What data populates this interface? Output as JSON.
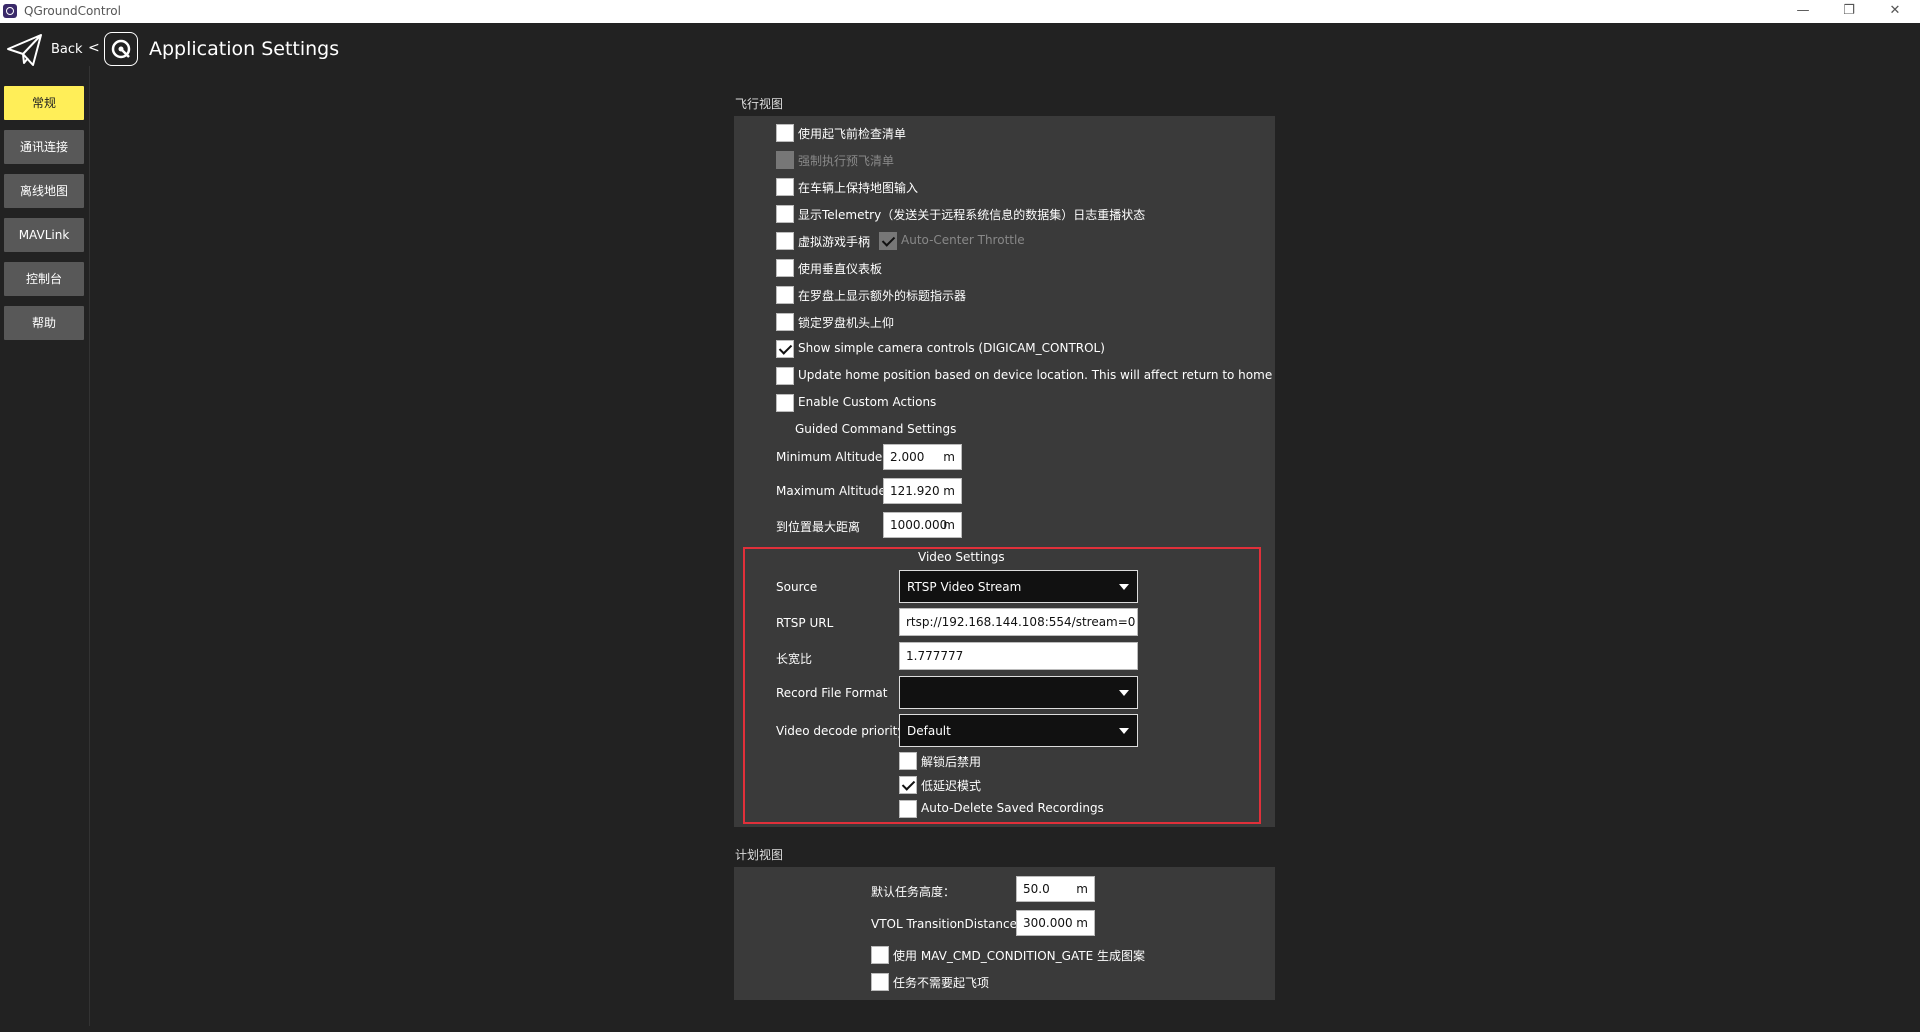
{
  "window": {
    "title": "QGroundControl",
    "minimize": "—",
    "maximize": "❐",
    "close": "✕"
  },
  "toolbar": {
    "back_label": "Back",
    "separator": "<",
    "title": "Application Settings"
  },
  "sidebar": {
    "items": [
      {
        "label": "常规",
        "active": true
      },
      {
        "label": "通讯连接",
        "active": false
      },
      {
        "label": "离线地图",
        "active": false
      },
      {
        "label": "MAVLink",
        "active": false
      },
      {
        "label": "控制台",
        "active": false
      },
      {
        "label": "帮助",
        "active": false
      }
    ]
  },
  "fly_view": {
    "section_title": "飞行视图",
    "checkboxes": [
      {
        "label": "使用起飞前检查清单",
        "checked": false,
        "disabled": false
      },
      {
        "label": "强制执行预飞清单",
        "checked": false,
        "disabled": true
      },
      {
        "label": "在车辆上保持地图输入",
        "checked": false,
        "disabled": false
      },
      {
        "label": "显示Telemetry（发送关于远程系统信息的数据集）日志重播状态",
        "checked": false,
        "disabled": false
      },
      {
        "label": "虚拟游戏手柄",
        "checked": false,
        "disabled": false
      },
      {
        "label": "使用垂直仪表板",
        "checked": false,
        "disabled": false
      },
      {
        "label": "在罗盘上显示额外的标题指示器",
        "checked": false,
        "disabled": false
      },
      {
        "label": "锁定罗盘机头上仰",
        "checked": false,
        "disabled": false
      },
      {
        "label": "Show simple camera controls (DIGICAM_CONTROL)",
        "checked": true,
        "disabled": false
      },
      {
        "label": "Update home position based on device location. This will affect return to home",
        "checked": false,
        "disabled": false
      },
      {
        "label": "Enable Custom Actions",
        "checked": false,
        "disabled": false
      }
    ],
    "auto_center_throttle": {
      "label": "Auto-Center Throttle",
      "checked": true,
      "disabled": true
    },
    "guided_title": "Guided Command Settings",
    "guided_fields": [
      {
        "label": "Minimum Altitude",
        "value": "2.000",
        "unit": "m"
      },
      {
        "label": "Maximum Altitude",
        "value": "121.920",
        "unit": "m"
      },
      {
        "label": "到位置最大距离",
        "value": "1000.000",
        "unit": "m"
      }
    ],
    "video": {
      "title": "Video Settings",
      "source_label": "Source",
      "source_value": "RTSP Video Stream",
      "rtsp_label": "RTSP URL",
      "rtsp_value": "rtsp://192.168.144.108:554/stream=0",
      "aspect_label": "长宽比",
      "aspect_value": "1.777777",
      "record_label": "Record File Format",
      "record_value": "",
      "decode_label": "Video decode priority",
      "decode_value": "Default",
      "checkboxes": [
        {
          "label": "解锁后禁用",
          "checked": false
        },
        {
          "label": "低延迟模式",
          "checked": true
        },
        {
          "label": "Auto-Delete Saved Recordings",
          "checked": false
        }
      ]
    }
  },
  "plan_view": {
    "section_title": "计划视图",
    "fields": [
      {
        "label": "默认任务高度：",
        "value": "50.0",
        "unit": "m"
      },
      {
        "label": "VTOL TransitionDistance",
        "value": "300.000",
        "unit": "m"
      }
    ],
    "checkboxes": [
      {
        "label": "使用 MAV_CMD_CONDITION_GATE 生成图案",
        "checked": false
      },
      {
        "label": "任务不需要起飞项",
        "checked": false
      }
    ]
  }
}
